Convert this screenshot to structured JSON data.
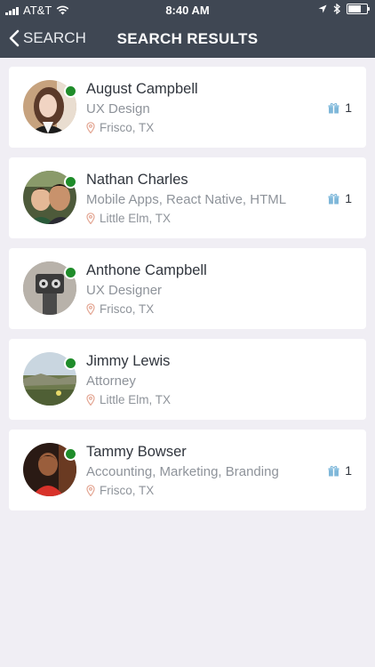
{
  "status_bar": {
    "carrier": "AT&T",
    "time": "8:40 AM",
    "battery_level": 0.8
  },
  "nav": {
    "back_label": "SEARCH",
    "title": "SEARCH RESULTS"
  },
  "results": [
    {
      "name": "August Campbell",
      "title": "UX Design",
      "location": "Frisco, TX",
      "online": true,
      "badge_count": "1"
    },
    {
      "name": "Nathan Charles",
      "title": "Mobile Apps, React Native, HTML",
      "location": "Little Elm, TX",
      "online": true,
      "badge_count": "1"
    },
    {
      "name": "Anthone Campbell",
      "title": "UX Designer",
      "location": "Frisco, TX",
      "online": true,
      "badge_count": ""
    },
    {
      "name": "Jimmy Lewis",
      "title": "Attorney",
      "location": "Little Elm, TX",
      "online": true,
      "badge_count": ""
    },
    {
      "name": "Tammy  Bowser",
      "title": "Accounting, Marketing, Branding",
      "location": "Frisco, TX",
      "online": true,
      "badge_count": "1"
    }
  ],
  "colors": {
    "header_bg": "#3f4753",
    "online": "#1f8c2a",
    "pin": "#e3a592",
    "gift": "#7fb7d9"
  }
}
